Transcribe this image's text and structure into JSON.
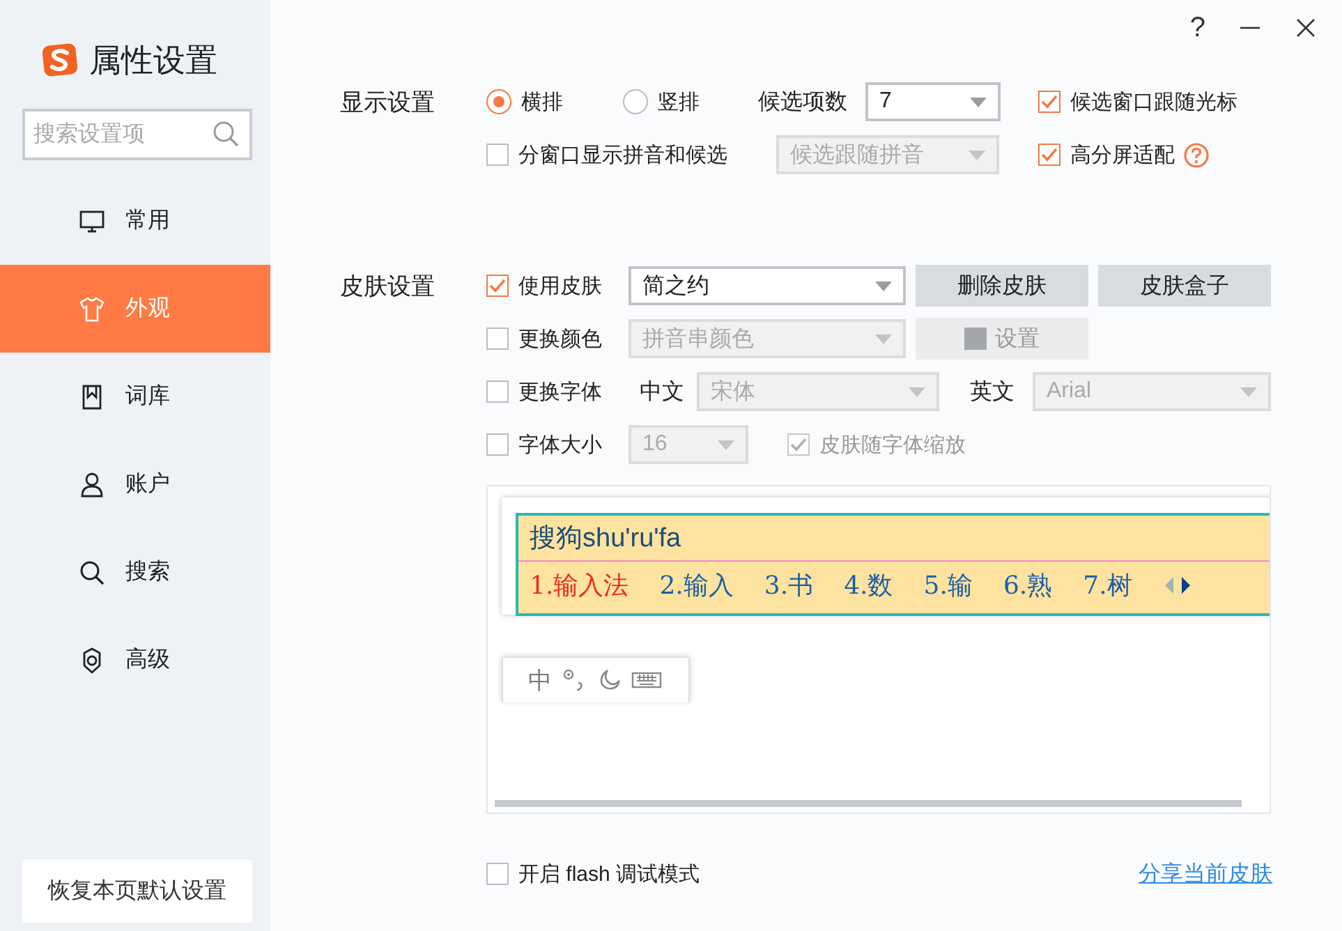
{
  "window": {
    "title": "属性设置",
    "help": "?"
  },
  "search": {
    "placeholder": "搜索设置项"
  },
  "sidebar": {
    "items": [
      {
        "label": "常用",
        "kind": "monitor",
        "selected": false
      },
      {
        "label": "外观",
        "kind": "shirt",
        "selected": true
      },
      {
        "label": "词库",
        "kind": "book",
        "selected": false
      },
      {
        "label": "账户",
        "kind": "person",
        "selected": false
      },
      {
        "label": "搜索",
        "kind": "search",
        "selected": false
      },
      {
        "label": "高级",
        "kind": "gear",
        "selected": false
      }
    ]
  },
  "restore_button": "恢复本页默认设置",
  "display": {
    "label": "显示设置",
    "layout_options": [
      {
        "label": "横排",
        "selected": true
      },
      {
        "label": "竖排",
        "selected": false
      }
    ],
    "candidate_count": {
      "label": "候选项数",
      "value": "7",
      "disabled": false
    },
    "follow_cursor": {
      "label": "候选窗口跟随光标",
      "checked": true,
      "disabled": false
    },
    "split_window": {
      "label": "分窗口显示拼音和候选",
      "checked": false,
      "disabled": false
    },
    "split_mode": {
      "value": "候选跟随拼音",
      "disabled": true
    },
    "hidpi": {
      "label": "高分屏适配",
      "checked": true,
      "disabled": false
    }
  },
  "skin": {
    "label": "皮肤设置",
    "use_skin": {
      "label": "使用皮肤",
      "checked": true,
      "disabled": false
    },
    "skin_name": {
      "value": "简之约",
      "disabled": false
    },
    "delete_button": {
      "label": "删除皮肤",
      "disabled": false
    },
    "box_button": {
      "label": "皮肤盒子",
      "disabled": false
    },
    "change_color": {
      "label": "更换颜色",
      "checked": false,
      "disabled": false
    },
    "color_target": {
      "value": "拼音串颜色",
      "disabled": true
    },
    "color_button": {
      "label": "设置",
      "disabled": true
    },
    "change_font": {
      "label": "更换字体",
      "checked": false,
      "disabled": false
    },
    "chinese_label": "中文",
    "chinese_font": {
      "value": "宋体",
      "disabled": true
    },
    "english_label": "英文",
    "english_font": {
      "value": "Arial",
      "disabled": true
    },
    "font_size": {
      "label": "字体大小",
      "checked": false,
      "disabled": false
    },
    "size_value": {
      "value": "16",
      "disabled": true
    },
    "scale_with_font": {
      "label": "皮肤随字体缩放",
      "checked": true,
      "disabled": true
    }
  },
  "preview": {
    "pinyin": "搜狗shu'ru'fa",
    "candidates": [
      {
        "text": "1.输入法",
        "selected": true
      },
      {
        "text": "2.输入",
        "selected": false
      },
      {
        "text": "3.书",
        "selected": false
      },
      {
        "text": "4.数",
        "selected": false
      },
      {
        "text": "5.输",
        "selected": false
      },
      {
        "text": "6.熟",
        "selected": false
      },
      {
        "text": "7.树",
        "selected": false
      }
    ],
    "toolbar_label": "中"
  },
  "flash_debug": {
    "label": "开启 flash 调试模式",
    "checked": false,
    "disabled": false
  },
  "share_link": "分享当前皮肤"
}
